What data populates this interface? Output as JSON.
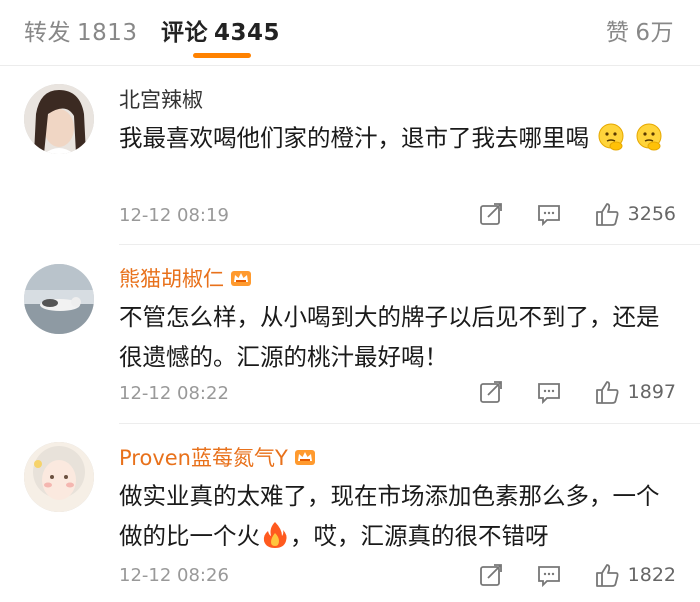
{
  "tabs": {
    "repost": {
      "label": "转发",
      "count": "1813"
    },
    "comment": {
      "label": "评论",
      "count": "4345"
    },
    "like": {
      "label": "赞",
      "count": "6万"
    }
  },
  "accent_color": "#ff8200",
  "vip_name_color": "#e8711b",
  "comments": [
    {
      "author": "北宫辣椒",
      "vip": false,
      "text_parts": [
        "我最喜欢喝他们家的橙汁，退市了我去哪里喝"
      ],
      "emojis": [
        "thinking-emoji",
        "thinking-emoji"
      ],
      "time": "12-12 08:19",
      "likes": "3256"
    },
    {
      "author": "熊猫胡椒仁",
      "vip": true,
      "text_parts": [
        "不管怎么样，从小喝到大的牌子以后见不到了，还是很遗憾的。汇源的桃汁最好喝！"
      ],
      "time": "12-12 08:22",
      "likes": "1897"
    },
    {
      "author": "Proven蓝莓氮气Y",
      "vip": true,
      "text_parts": [
        "做实业真的太难了，现在市场添加色素那么多，一个做的比一个火",
        "，哎，汇源真的很不错呀"
      ],
      "emojis": [
        "fire-emoji"
      ],
      "time": "12-12 08:26",
      "likes": "1822"
    }
  ]
}
